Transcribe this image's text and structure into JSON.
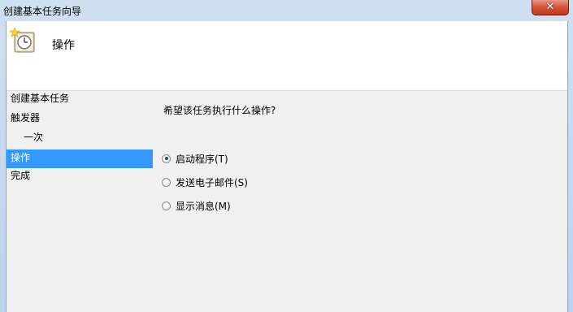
{
  "window": {
    "title": "创建基本任务向导",
    "close_glyph": "✕"
  },
  "header": {
    "title": "操作",
    "icon": "task-scheduler-clock-icon"
  },
  "steps": [
    {
      "label": "创建基本任务"
    },
    {
      "label": "触发器"
    },
    {
      "label": "一次"
    },
    {
      "label": "操作"
    },
    {
      "label": "完成"
    }
  ],
  "main": {
    "question": "希望该任务执行什么操作?",
    "options": [
      {
        "label": "启动程序(T)",
        "checked": true
      },
      {
        "label": "发送电子邮件(S)",
        "checked": false
      },
      {
        "label": "显示消息(M)",
        "checked": false
      }
    ]
  },
  "colors": {
    "selection": "#3399ff",
    "close_button": "#c2371c",
    "window_frame": "#bcd3ec"
  }
}
